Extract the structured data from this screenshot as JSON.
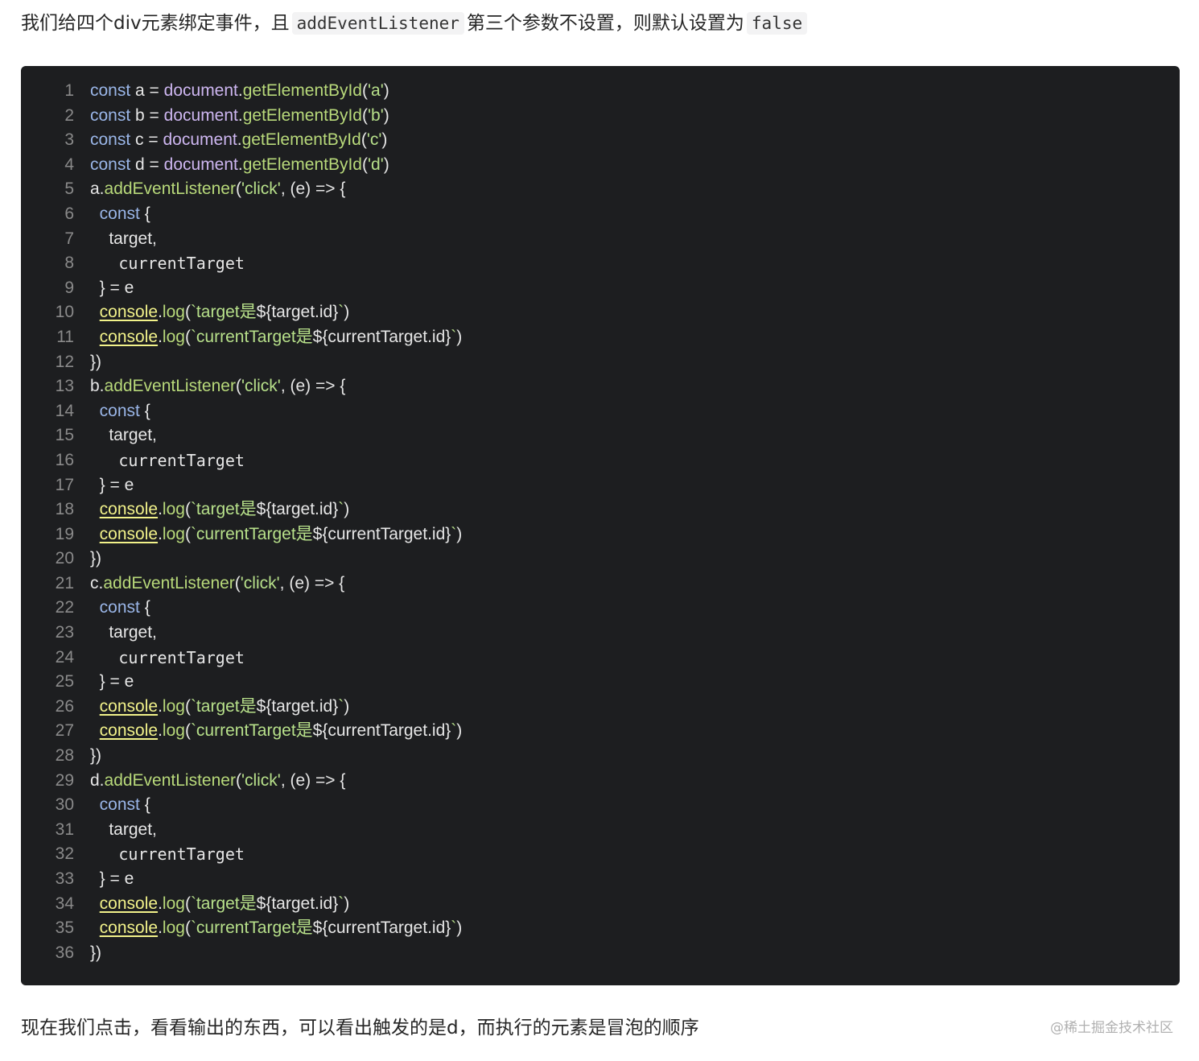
{
  "intro": {
    "text_before": "我们给四个div元素绑定事件，且",
    "code_1": "addEventListener",
    "text_middle": "第三个参数不设置，则默认设置为",
    "code_2": "false"
  },
  "code": {
    "lines": [
      {
        "no": "1",
        "segments": [
          {
            "t": "kw",
            "v": "const"
          },
          {
            "t": "pun",
            "v": " a = "
          },
          {
            "t": "obj",
            "v": "document"
          },
          {
            "t": "pun",
            "v": "."
          },
          {
            "t": "fn",
            "v": "getElementById"
          },
          {
            "t": "pun",
            "v": "("
          },
          {
            "t": "str",
            "v": "'a'"
          },
          {
            "t": "pun",
            "v": ")"
          }
        ]
      },
      {
        "no": "2",
        "segments": [
          {
            "t": "kw",
            "v": "const"
          },
          {
            "t": "pun",
            "v": " b = "
          },
          {
            "t": "obj",
            "v": "document"
          },
          {
            "t": "pun",
            "v": "."
          },
          {
            "t": "fn",
            "v": "getElementById"
          },
          {
            "t": "pun",
            "v": "("
          },
          {
            "t": "str",
            "v": "'b'"
          },
          {
            "t": "pun",
            "v": ")"
          }
        ]
      },
      {
        "no": "3",
        "segments": [
          {
            "t": "kw",
            "v": "const"
          },
          {
            "t": "pun",
            "v": " c = "
          },
          {
            "t": "obj",
            "v": "document"
          },
          {
            "t": "pun",
            "v": "."
          },
          {
            "t": "fn",
            "v": "getElementById"
          },
          {
            "t": "pun",
            "v": "("
          },
          {
            "t": "str",
            "v": "'c'"
          },
          {
            "t": "pun",
            "v": ")"
          }
        ]
      },
      {
        "no": "4",
        "segments": [
          {
            "t": "kw",
            "v": "const"
          },
          {
            "t": "pun",
            "v": " d = "
          },
          {
            "t": "obj",
            "v": "document"
          },
          {
            "t": "pun",
            "v": "."
          },
          {
            "t": "fn",
            "v": "getElementById"
          },
          {
            "t": "pun",
            "v": "("
          },
          {
            "t": "str",
            "v": "'d'"
          },
          {
            "t": "pun",
            "v": ")"
          }
        ]
      },
      {
        "no": "5",
        "segments": [
          {
            "t": "pun",
            "v": "a."
          },
          {
            "t": "fn",
            "v": "addEventListener"
          },
          {
            "t": "pun",
            "v": "("
          },
          {
            "t": "str",
            "v": "'click'"
          },
          {
            "t": "pun",
            "v": ", (e) => {"
          }
        ]
      },
      {
        "no": "6",
        "segments": [
          {
            "t": "pun",
            "v": "  "
          },
          {
            "t": "kw",
            "v": "const"
          },
          {
            "t": "pun",
            "v": " {"
          }
        ]
      },
      {
        "no": "7",
        "segments": [
          {
            "t": "pun",
            "v": "    target,"
          }
        ]
      },
      {
        "no": "8",
        "segments": [
          {
            "t": "pun",
            "v": "    "
          },
          {
            "t": "mono",
            "v": " currentTarget"
          }
        ]
      },
      {
        "no": "9",
        "segments": [
          {
            "t": "pun",
            "v": "  } = e"
          }
        ]
      },
      {
        "no": "10",
        "segments": [
          {
            "t": "pun",
            "v": "  "
          },
          {
            "t": "con",
            "v": "console"
          },
          {
            "t": "pun",
            "v": "."
          },
          {
            "t": "fn",
            "v": "log"
          },
          {
            "t": "pun",
            "v": "("
          },
          {
            "t": "str",
            "v": "`target是"
          },
          {
            "t": "pun",
            "v": "${target.id}"
          },
          {
            "t": "str",
            "v": "`"
          },
          {
            "t": "pun",
            "v": ")"
          }
        ]
      },
      {
        "no": "11",
        "segments": [
          {
            "t": "pun",
            "v": "  "
          },
          {
            "t": "con",
            "v": "console"
          },
          {
            "t": "pun",
            "v": "."
          },
          {
            "t": "fn",
            "v": "log"
          },
          {
            "t": "pun",
            "v": "("
          },
          {
            "t": "str",
            "v": "`currentTarget是"
          },
          {
            "t": "pun",
            "v": "${currentTarget.id}"
          },
          {
            "t": "str",
            "v": "`"
          },
          {
            "t": "pun",
            "v": ")"
          }
        ]
      },
      {
        "no": "12",
        "segments": [
          {
            "t": "pun",
            "v": "})"
          }
        ]
      },
      {
        "no": "13",
        "segments": [
          {
            "t": "pun",
            "v": "b."
          },
          {
            "t": "fn",
            "v": "addEventListener"
          },
          {
            "t": "pun",
            "v": "("
          },
          {
            "t": "str",
            "v": "'click'"
          },
          {
            "t": "pun",
            "v": ", (e) => {"
          }
        ]
      },
      {
        "no": "14",
        "segments": [
          {
            "t": "pun",
            "v": "  "
          },
          {
            "t": "kw",
            "v": "const"
          },
          {
            "t": "pun",
            "v": " {"
          }
        ]
      },
      {
        "no": "15",
        "segments": [
          {
            "t": "pun",
            "v": "    target,"
          }
        ]
      },
      {
        "no": "16",
        "segments": [
          {
            "t": "pun",
            "v": "    "
          },
          {
            "t": "mono",
            "v": " currentTarget"
          }
        ]
      },
      {
        "no": "17",
        "segments": [
          {
            "t": "pun",
            "v": "  } = e"
          }
        ]
      },
      {
        "no": "18",
        "segments": [
          {
            "t": "pun",
            "v": "  "
          },
          {
            "t": "con",
            "v": "console"
          },
          {
            "t": "pun",
            "v": "."
          },
          {
            "t": "fn",
            "v": "log"
          },
          {
            "t": "pun",
            "v": "("
          },
          {
            "t": "str",
            "v": "`target是"
          },
          {
            "t": "pun",
            "v": "${target.id}"
          },
          {
            "t": "str",
            "v": "`"
          },
          {
            "t": "pun",
            "v": ")"
          }
        ]
      },
      {
        "no": "19",
        "segments": [
          {
            "t": "pun",
            "v": "  "
          },
          {
            "t": "con",
            "v": "console"
          },
          {
            "t": "pun",
            "v": "."
          },
          {
            "t": "fn",
            "v": "log"
          },
          {
            "t": "pun",
            "v": "("
          },
          {
            "t": "str",
            "v": "`currentTarget是"
          },
          {
            "t": "pun",
            "v": "${currentTarget.id}"
          },
          {
            "t": "str",
            "v": "`"
          },
          {
            "t": "pun",
            "v": ")"
          }
        ]
      },
      {
        "no": "20",
        "segments": [
          {
            "t": "pun",
            "v": "})"
          }
        ]
      },
      {
        "no": "21",
        "segments": [
          {
            "t": "pun",
            "v": "c."
          },
          {
            "t": "fn",
            "v": "addEventListener"
          },
          {
            "t": "pun",
            "v": "("
          },
          {
            "t": "str",
            "v": "'click'"
          },
          {
            "t": "pun",
            "v": ", (e) => {"
          }
        ]
      },
      {
        "no": "22",
        "segments": [
          {
            "t": "pun",
            "v": "  "
          },
          {
            "t": "kw",
            "v": "const"
          },
          {
            "t": "pun",
            "v": " {"
          }
        ]
      },
      {
        "no": "23",
        "segments": [
          {
            "t": "pun",
            "v": "    target,"
          }
        ]
      },
      {
        "no": "24",
        "segments": [
          {
            "t": "pun",
            "v": "    "
          },
          {
            "t": "mono",
            "v": " currentTarget"
          }
        ]
      },
      {
        "no": "25",
        "segments": [
          {
            "t": "pun",
            "v": "  } = e"
          }
        ]
      },
      {
        "no": "26",
        "segments": [
          {
            "t": "pun",
            "v": "  "
          },
          {
            "t": "con",
            "v": "console"
          },
          {
            "t": "pun",
            "v": "."
          },
          {
            "t": "fn",
            "v": "log"
          },
          {
            "t": "pun",
            "v": "("
          },
          {
            "t": "str",
            "v": "`target是"
          },
          {
            "t": "pun",
            "v": "${target.id}"
          },
          {
            "t": "str",
            "v": "`"
          },
          {
            "t": "pun",
            "v": ")"
          }
        ]
      },
      {
        "no": "27",
        "segments": [
          {
            "t": "pun",
            "v": "  "
          },
          {
            "t": "con",
            "v": "console"
          },
          {
            "t": "pun",
            "v": "."
          },
          {
            "t": "fn",
            "v": "log"
          },
          {
            "t": "pun",
            "v": "("
          },
          {
            "t": "str",
            "v": "`currentTarget是"
          },
          {
            "t": "pun",
            "v": "${currentTarget.id}"
          },
          {
            "t": "str",
            "v": "`"
          },
          {
            "t": "pun",
            "v": ")"
          }
        ]
      },
      {
        "no": "28",
        "segments": [
          {
            "t": "pun",
            "v": "})"
          }
        ]
      },
      {
        "no": "29",
        "segments": [
          {
            "t": "pun",
            "v": "d."
          },
          {
            "t": "fn",
            "v": "addEventListener"
          },
          {
            "t": "pun",
            "v": "("
          },
          {
            "t": "str",
            "v": "'click'"
          },
          {
            "t": "pun",
            "v": ", (e) => {"
          }
        ]
      },
      {
        "no": "30",
        "segments": [
          {
            "t": "pun",
            "v": "  "
          },
          {
            "t": "kw",
            "v": "const"
          },
          {
            "t": "pun",
            "v": " {"
          }
        ]
      },
      {
        "no": "31",
        "segments": [
          {
            "t": "pun",
            "v": "    target,"
          }
        ]
      },
      {
        "no": "32",
        "segments": [
          {
            "t": "pun",
            "v": "    "
          },
          {
            "t": "mono",
            "v": " currentTarget"
          }
        ]
      },
      {
        "no": "33",
        "segments": [
          {
            "t": "pun",
            "v": "  } = e"
          }
        ]
      },
      {
        "no": "34",
        "segments": [
          {
            "t": "pun",
            "v": "  "
          },
          {
            "t": "con",
            "v": "console"
          },
          {
            "t": "pun",
            "v": "."
          },
          {
            "t": "fn",
            "v": "log"
          },
          {
            "t": "pun",
            "v": "("
          },
          {
            "t": "str",
            "v": "`target是"
          },
          {
            "t": "pun",
            "v": "${target.id}"
          },
          {
            "t": "str",
            "v": "`"
          },
          {
            "t": "pun",
            "v": ")"
          }
        ]
      },
      {
        "no": "35",
        "segments": [
          {
            "t": "pun",
            "v": "  "
          },
          {
            "t": "con",
            "v": "console"
          },
          {
            "t": "pun",
            "v": "."
          },
          {
            "t": "fn",
            "v": "log"
          },
          {
            "t": "pun",
            "v": "("
          },
          {
            "t": "str",
            "v": "`currentTarget是"
          },
          {
            "t": "pun",
            "v": "${currentTarget.id}"
          },
          {
            "t": "str",
            "v": "`"
          },
          {
            "t": "pun",
            "v": ")"
          }
        ]
      },
      {
        "no": "36",
        "segments": [
          {
            "t": "pun",
            "v": "})"
          }
        ]
      }
    ]
  },
  "outro": {
    "text": "现在我们点击，看看输出的东西，可以看出触发的是d，而执行的元素是冒泡的顺序"
  },
  "watermark": {
    "text": "@稀土掘金技术社区"
  },
  "colors": {
    "code_background": "#1d1e20",
    "keyword": "#9ab6e8",
    "string": "#b7e08a",
    "console": "#f2f28a"
  }
}
